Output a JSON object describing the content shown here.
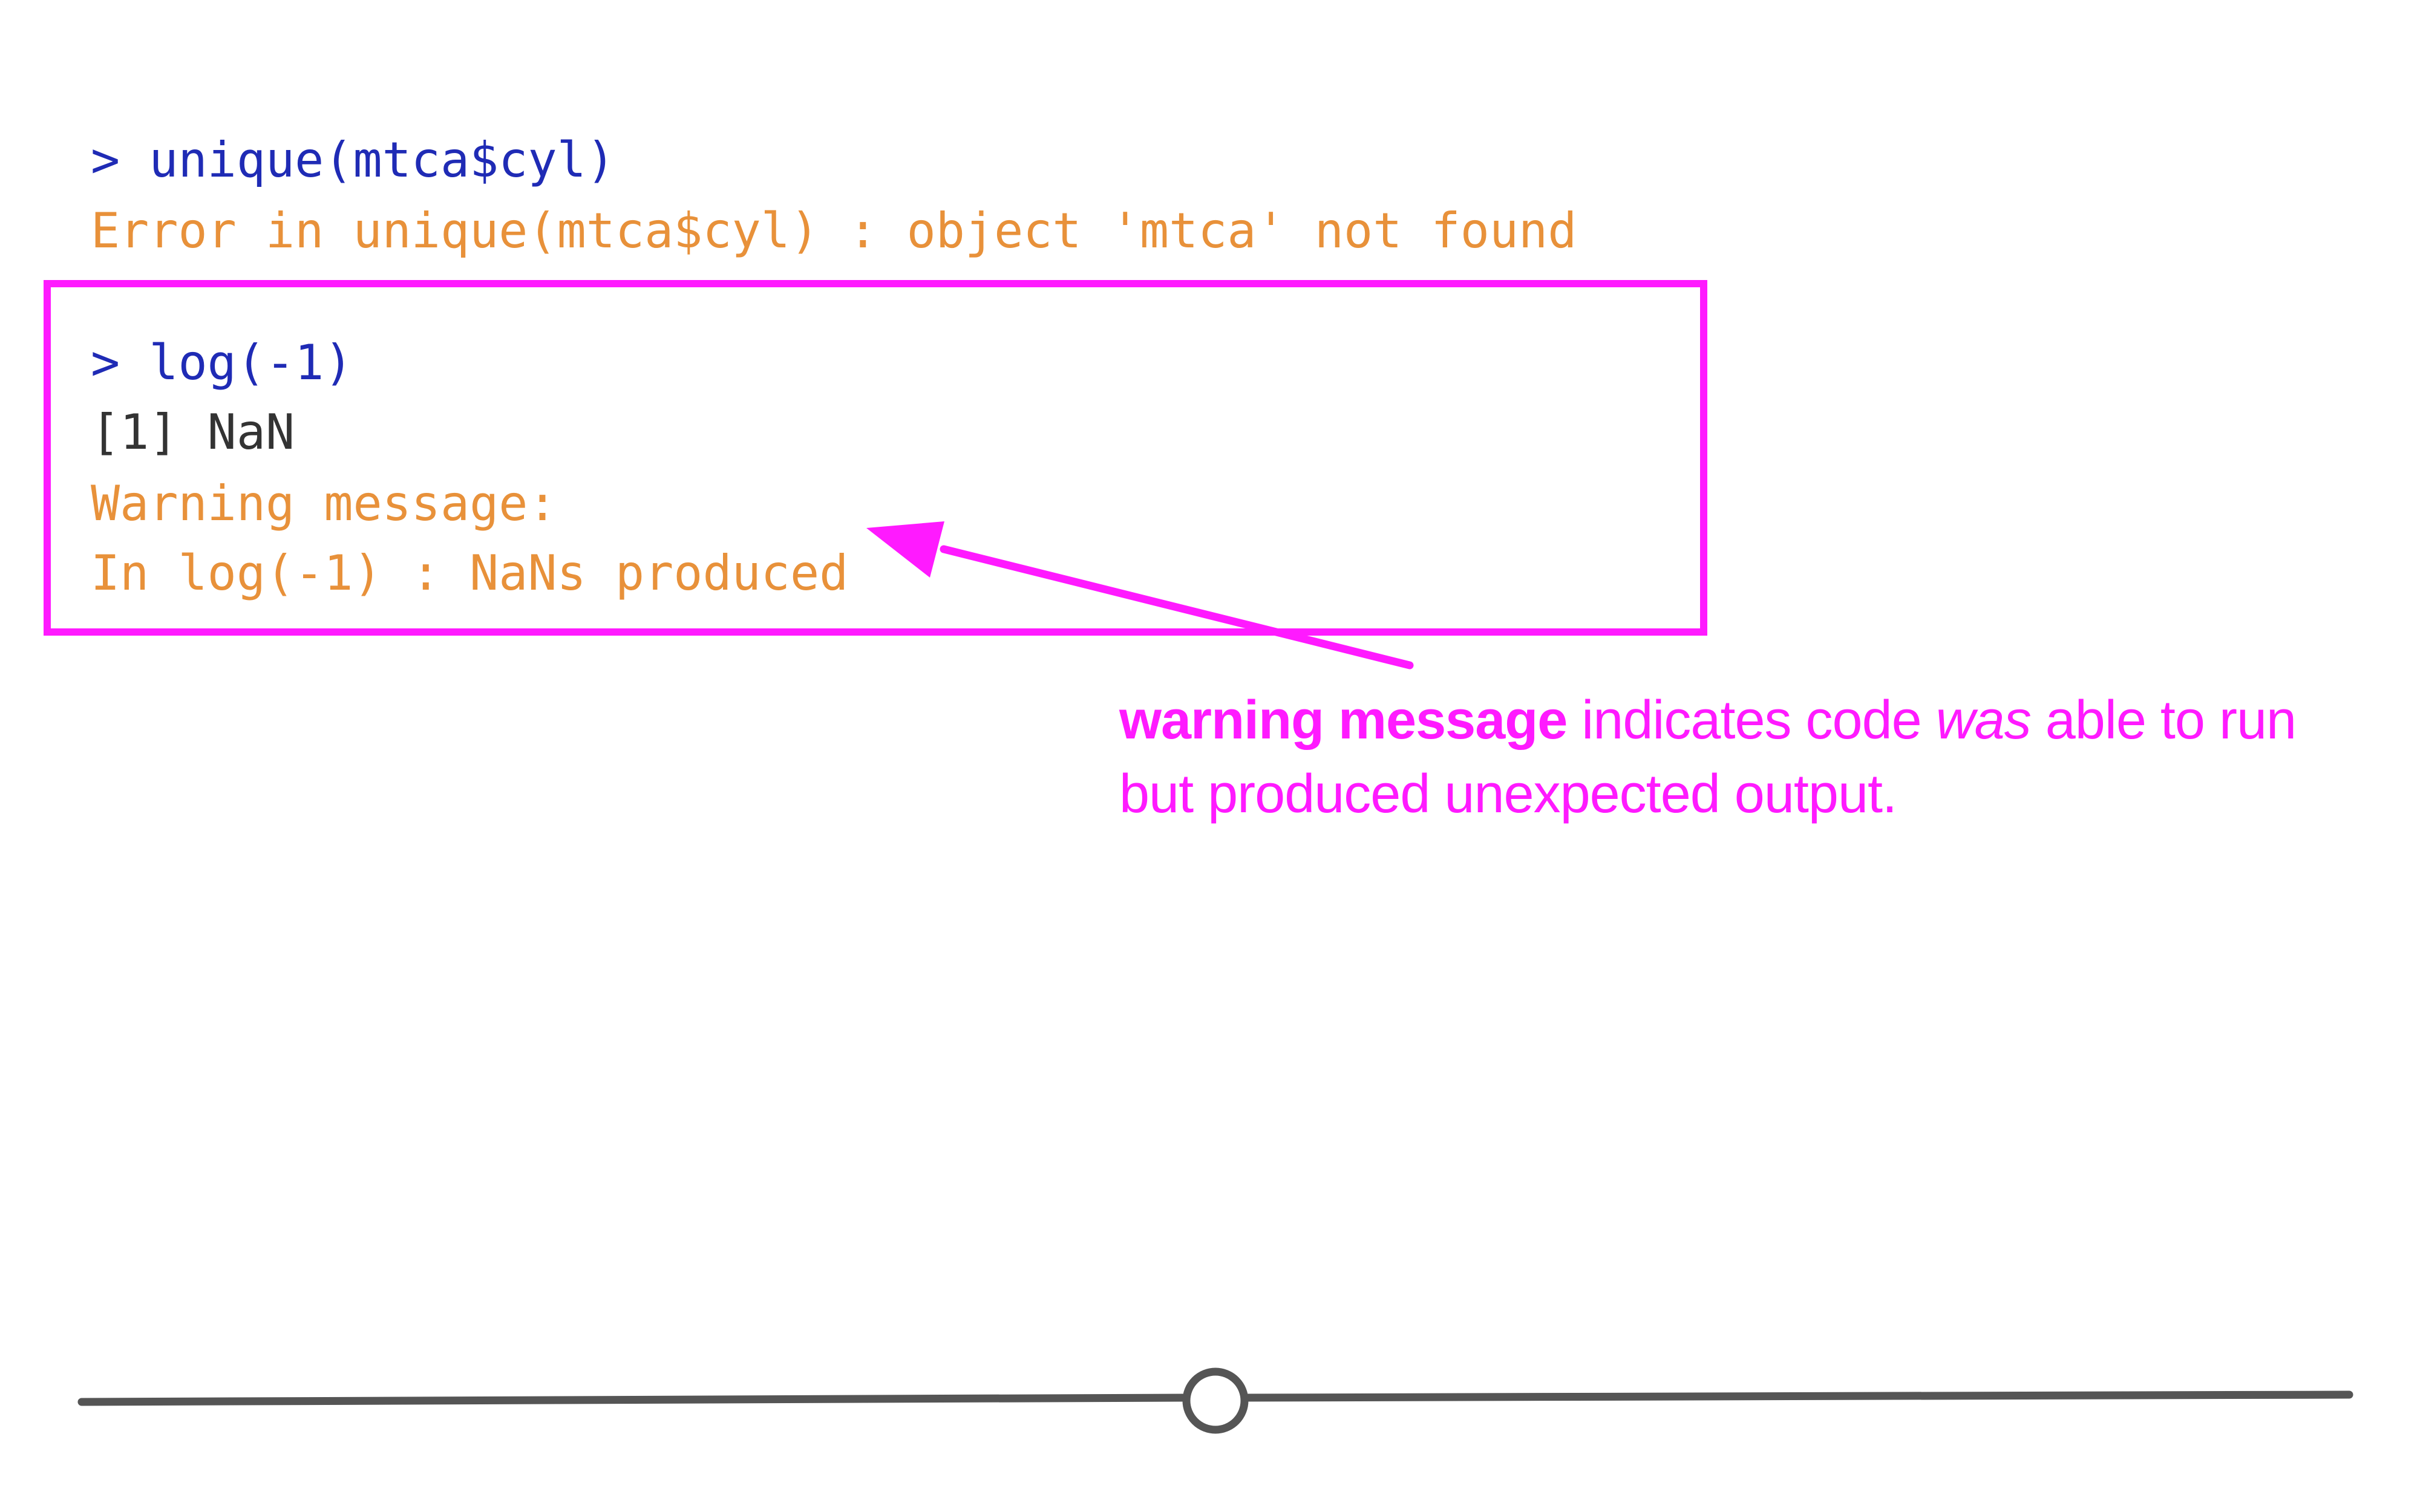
{
  "console": {
    "cmd1": "> unique(mtca$cyl)",
    "err1": "Error in unique(mtca$cyl) : object 'mtca' not found",
    "cmd2": "> log(-1)",
    "out2": "[1] NaN",
    "warn_title": "Warning message:",
    "warn_detail": "In log(-1) : NaNs produced"
  },
  "annotation": {
    "bold": "warning message",
    "text1": " indicates code ",
    "italic": "was",
    "text2": " able to run",
    "line2": "but produced unexpected output."
  },
  "slider": {
    "position": 0.5
  },
  "colors": {
    "prompt": "#1f2bb5",
    "error": "#e8913a",
    "highlight": "#ff1aff",
    "slider_track": "#555555"
  }
}
